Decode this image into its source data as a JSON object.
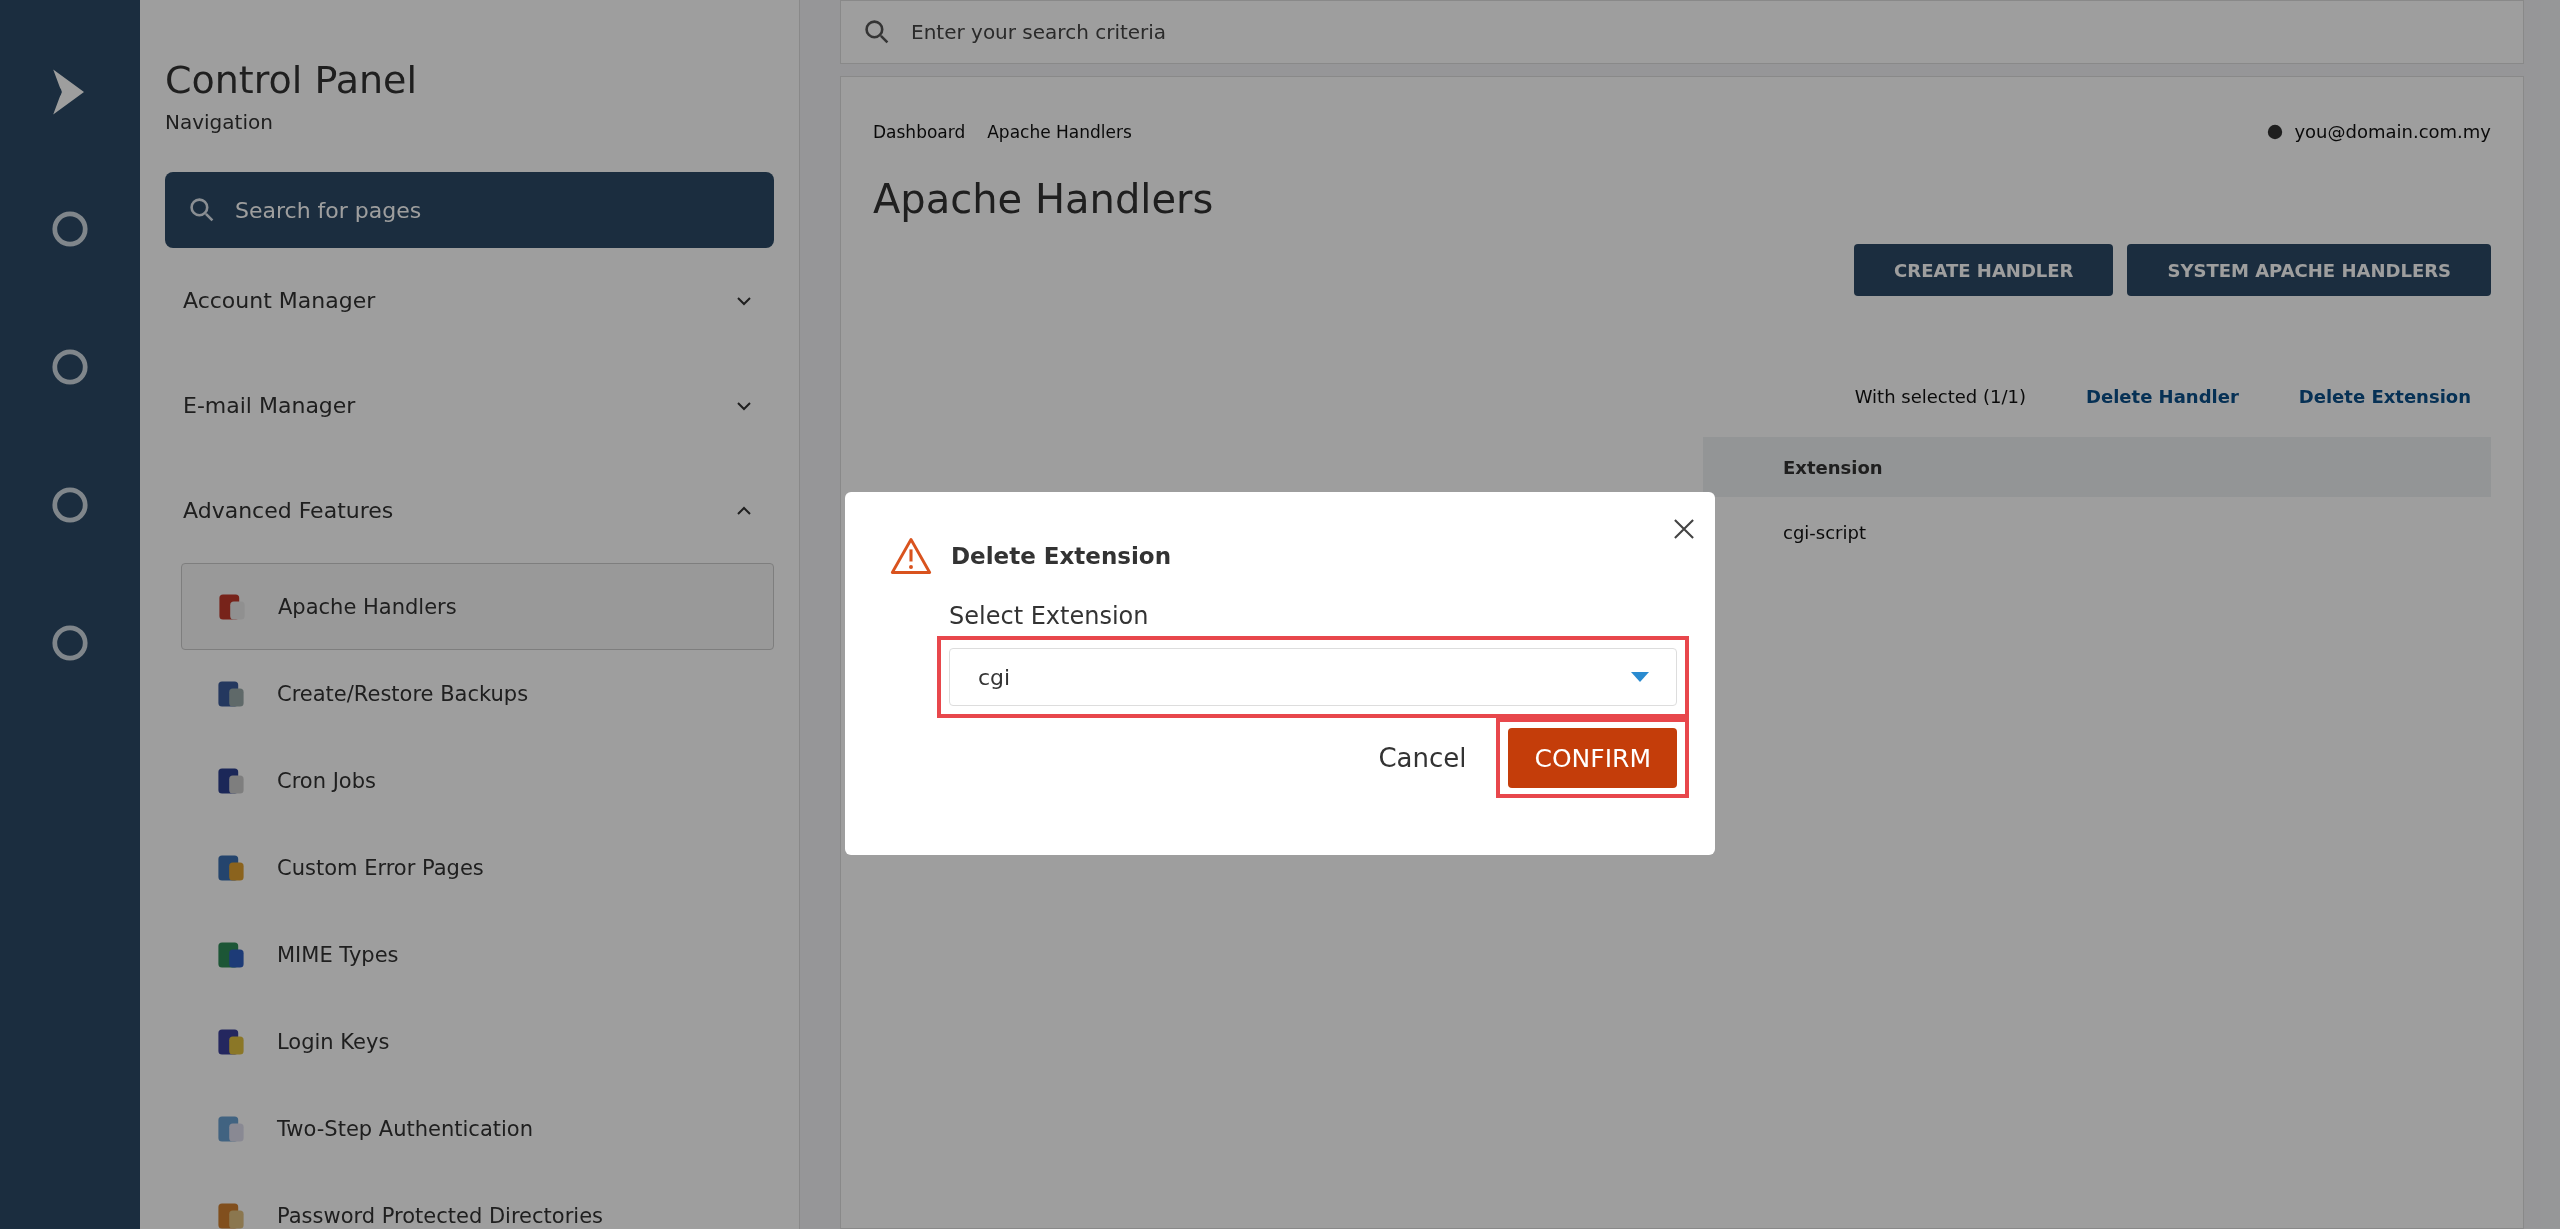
{
  "sidebar": {
    "title": "Control Panel",
    "subtitle": "Navigation",
    "search": {
      "placeholder": "Search for pages"
    },
    "groups": [
      {
        "label": "Account Manager",
        "expanded": false
      },
      {
        "label": "E-mail Manager",
        "expanded": false
      },
      {
        "label": "Advanced Features",
        "expanded": true,
        "children": [
          {
            "label": "Apache Handlers",
            "selected": true
          },
          {
            "label": "Create/Restore Backups",
            "selected": false
          },
          {
            "label": "Cron Jobs",
            "selected": false
          },
          {
            "label": "Custom Error Pages",
            "selected": false
          },
          {
            "label": "MIME Types",
            "selected": false
          },
          {
            "label": "Login Keys",
            "selected": false
          },
          {
            "label": "Two-Step Authentication",
            "selected": false
          },
          {
            "label": "Password Protected Directories",
            "selected": false
          }
        ]
      }
    ]
  },
  "topbar": {
    "search": {
      "placeholder": "Enter your search criteria"
    }
  },
  "breadcrumbs": [
    "Dashboard",
    "Apache Handlers"
  ],
  "account": "you@domain.com.my",
  "page_title": "Apache Handlers",
  "actions": [
    "CREATE HANDLER",
    "SYSTEM APACHE HANDLERS"
  ],
  "bulk": {
    "label": "With selected (1/1)",
    "links": [
      "Delete Handler",
      "Delete Extension"
    ]
  },
  "table": {
    "columns": [
      "Extension"
    ],
    "rows": [
      [
        "cgi-script"
      ]
    ]
  },
  "dialog": {
    "title": "Delete Extension",
    "field": {
      "label": "Select Extension",
      "value": "cgi"
    },
    "buttons": {
      "cancel": "Cancel",
      "confirm": "CONFIRM"
    },
    "highlighted": true
  }
}
